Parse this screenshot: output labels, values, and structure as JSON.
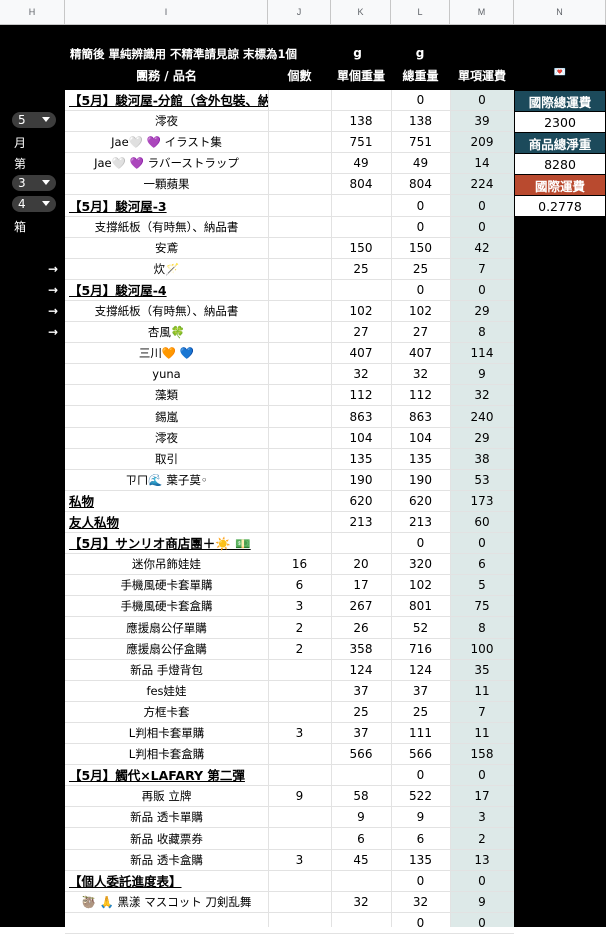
{
  "columns": [
    "H",
    "I",
    "J",
    "K",
    "L",
    "M",
    "N"
  ],
  "header": {
    "note": "精簡後 單純辨識用 不精準請見諒  末標為1個",
    "group": "團務 / 品名",
    "qty": "個數",
    "unit_weight": "單個重量",
    "total_weight": "總重量",
    "item_shipping": "單項運費",
    "g1": "g",
    "g2": "g",
    "heart": "💌"
  },
  "side": {
    "month_value": "5",
    "month_label": "月",
    "order_label": "第",
    "order_value": "3",
    "box_value": "4",
    "box_label": "箱",
    "arrow": "→"
  },
  "summary": {
    "intl_total_label": "國際總運費",
    "intl_total_value": "2300",
    "net_weight_label": "商品總淨重",
    "net_weight_value": "8280",
    "intl_rate_label": "國際運費",
    "intl_rate_value": "0.2778"
  },
  "rows": [
    {
      "name": "【5月】駿河屋-分館（含外包裝、納品書）",
      "qty": "",
      "unit": "",
      "total": "0",
      "ship": "0",
      "section": true
    },
    {
      "name": "澪夜",
      "qty": "",
      "unit": "138",
      "total": "138",
      "ship": "39"
    },
    {
      "name": "Jae🤍 💜 イラスト集",
      "qty": "",
      "unit": "751",
      "total": "751",
      "ship": "209"
    },
    {
      "name": "Jae🤍 💜 ラバーストラップ",
      "qty": "",
      "unit": "49",
      "total": "49",
      "ship": "14"
    },
    {
      "name": "一顆蘋果",
      "qty": "",
      "unit": "804",
      "total": "804",
      "ship": "224"
    },
    {
      "name": "【5月】駿河屋-3",
      "qty": "",
      "unit": "",
      "total": "0",
      "ship": "0",
      "section": true
    },
    {
      "name": "支撐紙板（有時無）、納品書",
      "qty": "",
      "unit": "",
      "total": "0",
      "ship": "0"
    },
    {
      "name": "安鳶",
      "qty": "",
      "unit": "150",
      "total": "150",
      "ship": "42"
    },
    {
      "name": "炊🪄",
      "qty": "",
      "unit": "25",
      "total": "25",
      "ship": "7"
    },
    {
      "name": "【5月】駿河屋-4",
      "qty": "",
      "unit": "",
      "total": "0",
      "ship": "0",
      "section": true
    },
    {
      "name": "支撐紙板（有時無）、納品書",
      "qty": "",
      "unit": "102",
      "total": "102",
      "ship": "29"
    },
    {
      "name": "杏風🍀",
      "qty": "",
      "unit": "27",
      "total": "27",
      "ship": "8"
    },
    {
      "name": "三川🧡 💙",
      "qty": "",
      "unit": "407",
      "total": "407",
      "ship": "114"
    },
    {
      "name": "yuna",
      "qty": "",
      "unit": "32",
      "total": "32",
      "ship": "9"
    },
    {
      "name": "藻類",
      "qty": "",
      "unit": "112",
      "total": "112",
      "ship": "32"
    },
    {
      "name": "錫嵐",
      "qty": "",
      "unit": "863",
      "total": "863",
      "ship": "240"
    },
    {
      "name": "澪夜",
      "qty": "",
      "unit": "104",
      "total": "104",
      "ship": "29"
    },
    {
      "name": "取引",
      "qty": "",
      "unit": "135",
      "total": "135",
      "ship": "38"
    },
    {
      "name": "ㄗㄇ🌊 葉子莫◦",
      "qty": "",
      "unit": "190",
      "total": "190",
      "ship": "53"
    },
    {
      "name": "私物",
      "qty": "",
      "unit": "620",
      "total": "620",
      "ship": "173",
      "section": true
    },
    {
      "name": "友人私物",
      "qty": "",
      "unit": "213",
      "total": "213",
      "ship": "60",
      "section": true
    },
    {
      "name": "【5月】サンリオ商店團＋☀️ 💵",
      "qty": "",
      "unit": "",
      "total": "0",
      "ship": "0",
      "section": true
    },
    {
      "name": "迷你吊飾娃娃",
      "qty": "16",
      "unit": "20",
      "total": "320",
      "ship": "6"
    },
    {
      "name": "手機風硬卡套單購",
      "qty": "6",
      "unit": "17",
      "total": "102",
      "ship": "5"
    },
    {
      "name": "手機風硬卡套盒購",
      "qty": "3",
      "unit": "267",
      "total": "801",
      "ship": "75"
    },
    {
      "name": "應援扇公仔單購",
      "qty": "2",
      "unit": "26",
      "total": "52",
      "ship": "8"
    },
    {
      "name": "應援扇公仔盒購",
      "qty": "2",
      "unit": "358",
      "total": "716",
      "ship": "100"
    },
    {
      "name": "新品 手燈背包",
      "qty": "",
      "unit": "124",
      "total": "124",
      "ship": "35"
    },
    {
      "name": "fes娃娃",
      "qty": "",
      "unit": "37",
      "total": "37",
      "ship": "11"
    },
    {
      "name": "方框卡套",
      "qty": "",
      "unit": "25",
      "total": "25",
      "ship": "7"
    },
    {
      "name": "L判相卡套單購",
      "qty": "3",
      "unit": "37",
      "total": "111",
      "ship": "11"
    },
    {
      "name": "L判相卡套盒購",
      "qty": "",
      "unit": "566",
      "total": "566",
      "ship": "158"
    },
    {
      "name": "【5月】觸代×LAFARY 第二彈",
      "qty": "",
      "unit": "",
      "total": "0",
      "ship": "0",
      "section": true
    },
    {
      "name": "再販 立牌",
      "qty": "9",
      "unit": "58",
      "total": "522",
      "ship": "17"
    },
    {
      "name": "新品 透卡單購",
      "qty": "",
      "unit": "9",
      "total": "9",
      "ship": "3"
    },
    {
      "name": "新品 收藏票券",
      "qty": "",
      "unit": "6",
      "total": "6",
      "ship": "2"
    },
    {
      "name": "新品 透卡盒購",
      "qty": "3",
      "unit": "45",
      "total": "135",
      "ship": "13"
    },
    {
      "name": "【個人委託進度表】",
      "qty": "",
      "unit": "",
      "total": "0",
      "ship": "0",
      "section": true
    },
    {
      "name": "🦥 🙏 黑漾 マスコット 刀剣乱舞",
      "qty": "",
      "unit": "32",
      "total": "32",
      "ship": "9"
    },
    {
      "name": "",
      "qty": "",
      "unit": "",
      "total": "0",
      "ship": "0"
    }
  ]
}
